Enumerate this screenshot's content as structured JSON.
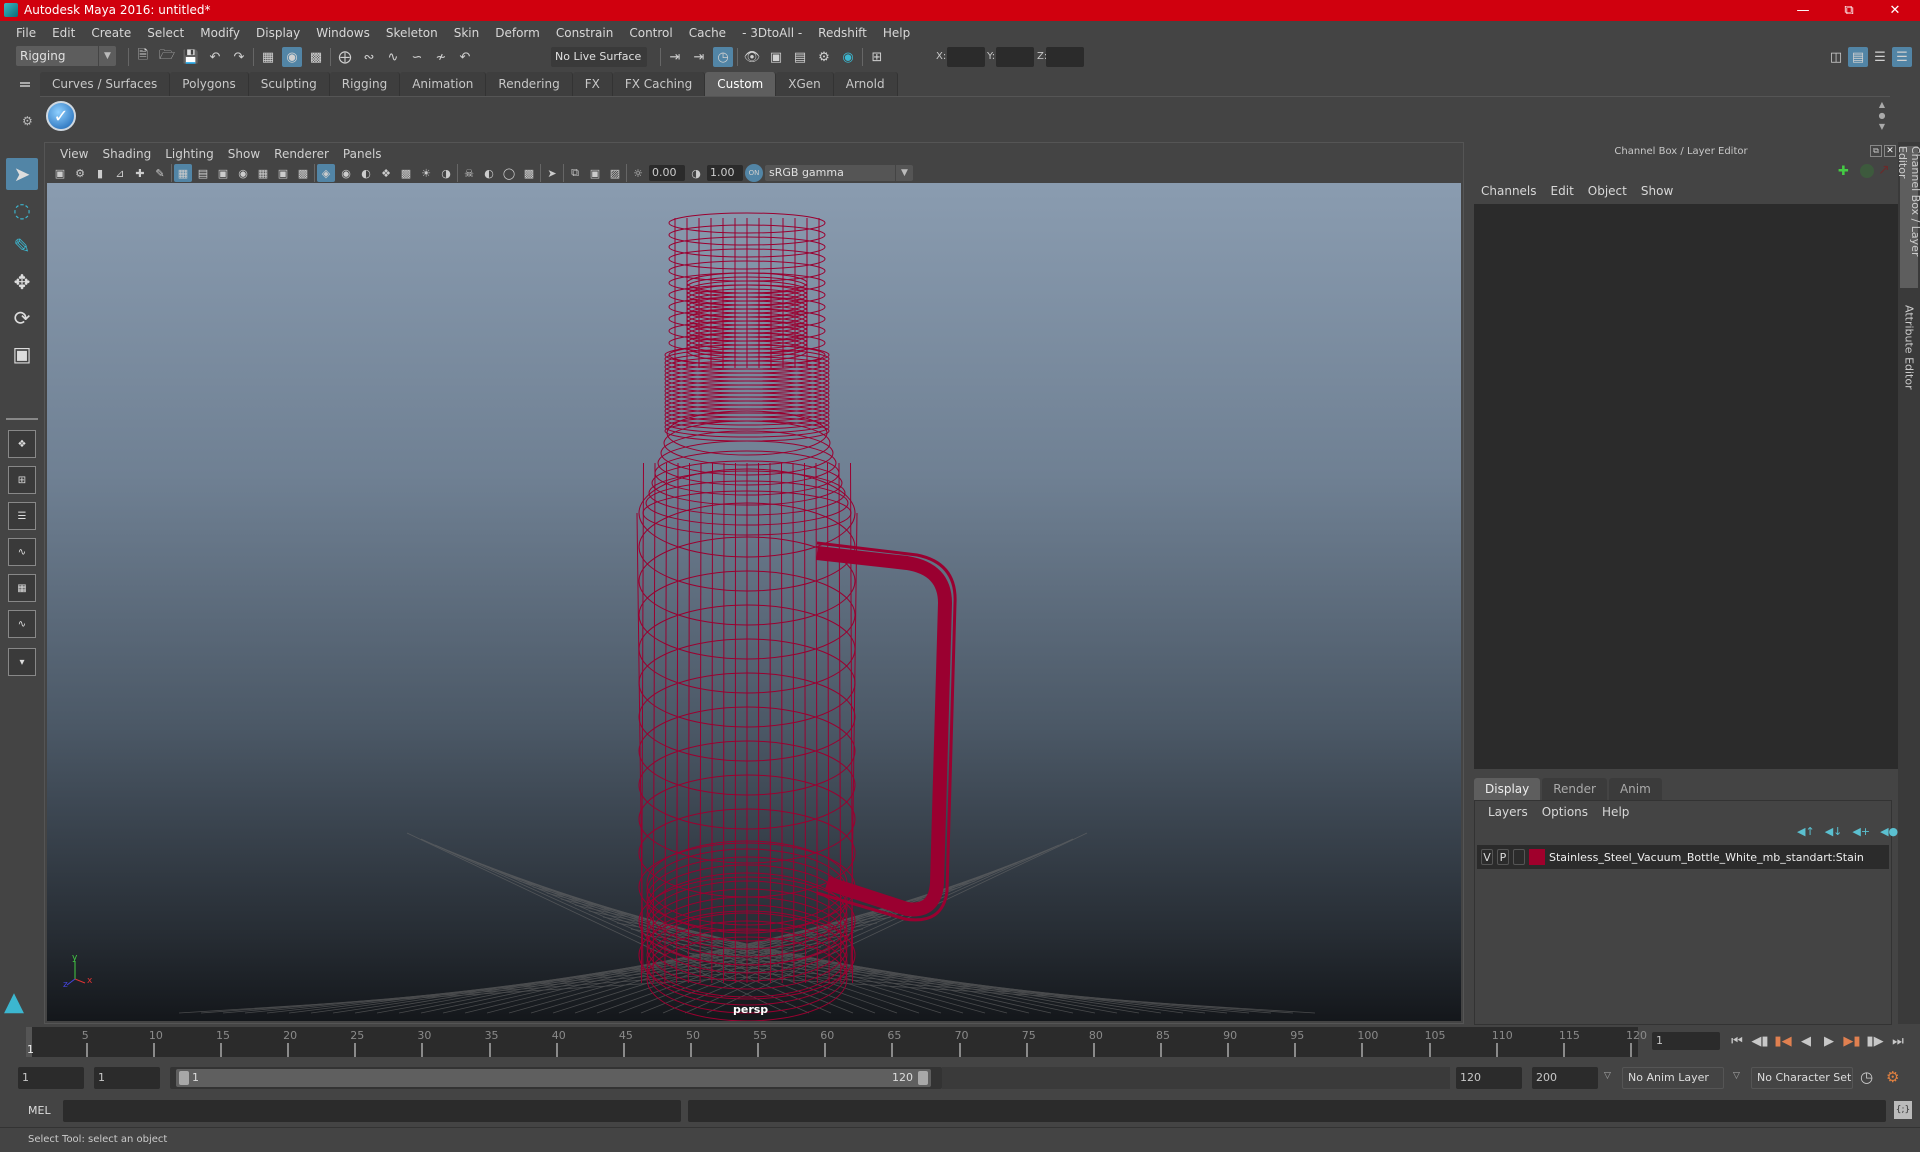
{
  "window": {
    "title": "Autodesk Maya 2016: untitled*",
    "controls": [
      "minimize",
      "restore",
      "close"
    ]
  },
  "menubar": [
    "File",
    "Edit",
    "Create",
    "Select",
    "Modify",
    "Display",
    "Windows",
    "Skeleton",
    "Skin",
    "Deform",
    "Constrain",
    "Control",
    "Cache",
    "- 3DtoAll -",
    "Redshift",
    "Help"
  ],
  "statusline": {
    "menuset": "Rigging",
    "live_surface": "No Live Surface",
    "xyz_labels": [
      "X:",
      "Y:",
      "Z:"
    ],
    "xyz_values": [
      "",
      "",
      ""
    ]
  },
  "shelf": {
    "tabs": [
      "Curves / Surfaces",
      "Polygons",
      "Sculpting",
      "Rigging",
      "Animation",
      "Rendering",
      "FX",
      "FX Caching",
      "Custom",
      "XGen",
      "Arnold"
    ],
    "active_tab": "Custom",
    "items": [
      {
        "icon": "checkmark-icon"
      }
    ]
  },
  "viewport": {
    "menu": [
      "View",
      "Shading",
      "Lighting",
      "Show",
      "Renderer",
      "Panels"
    ],
    "exposure": "0.00",
    "gamma": "1.00",
    "color_space": "sRGB gamma",
    "camera_label": "persp",
    "axis_labels": {
      "x": "x",
      "y": "y",
      "z": "z"
    },
    "wire_color": "#9a0030"
  },
  "channel_box": {
    "title": "Channel Box / Layer Editor",
    "menu": [
      "Channels",
      "Edit",
      "Object",
      "Show"
    ]
  },
  "layer_editor": {
    "tabs": [
      "Display",
      "Render",
      "Anim"
    ],
    "active_tab": "Display",
    "menu": [
      "Layers",
      "Options",
      "Help"
    ],
    "layers": [
      {
        "visible": "V",
        "playback": "P",
        "color": "#a0002c",
        "name": "Stainless_Steel_Vacuum_Bottle_White_mb_standart:Stain"
      }
    ]
  },
  "side_tabs": [
    "Channel Box / Layer Editor",
    "Attribute Editor"
  ],
  "timeline": {
    "ticks": [
      5,
      10,
      15,
      20,
      25,
      30,
      35,
      40,
      45,
      50,
      55,
      60,
      65,
      70,
      75,
      80,
      85,
      90,
      95,
      100,
      105,
      110,
      115,
      120
    ],
    "range_min": 1,
    "range_max": 120,
    "current_frame_marker": "1",
    "current_frame": "1"
  },
  "range": {
    "start": "1",
    "playback_start": "1",
    "slider_start": "1",
    "slider_end": "120",
    "playback_end": "120",
    "end": "200",
    "anim_layer": "No Anim Layer",
    "character_set": "No Character Set"
  },
  "command": {
    "language": "MEL",
    "input": "",
    "result": ""
  },
  "help_line": "Select Tool: select an object"
}
